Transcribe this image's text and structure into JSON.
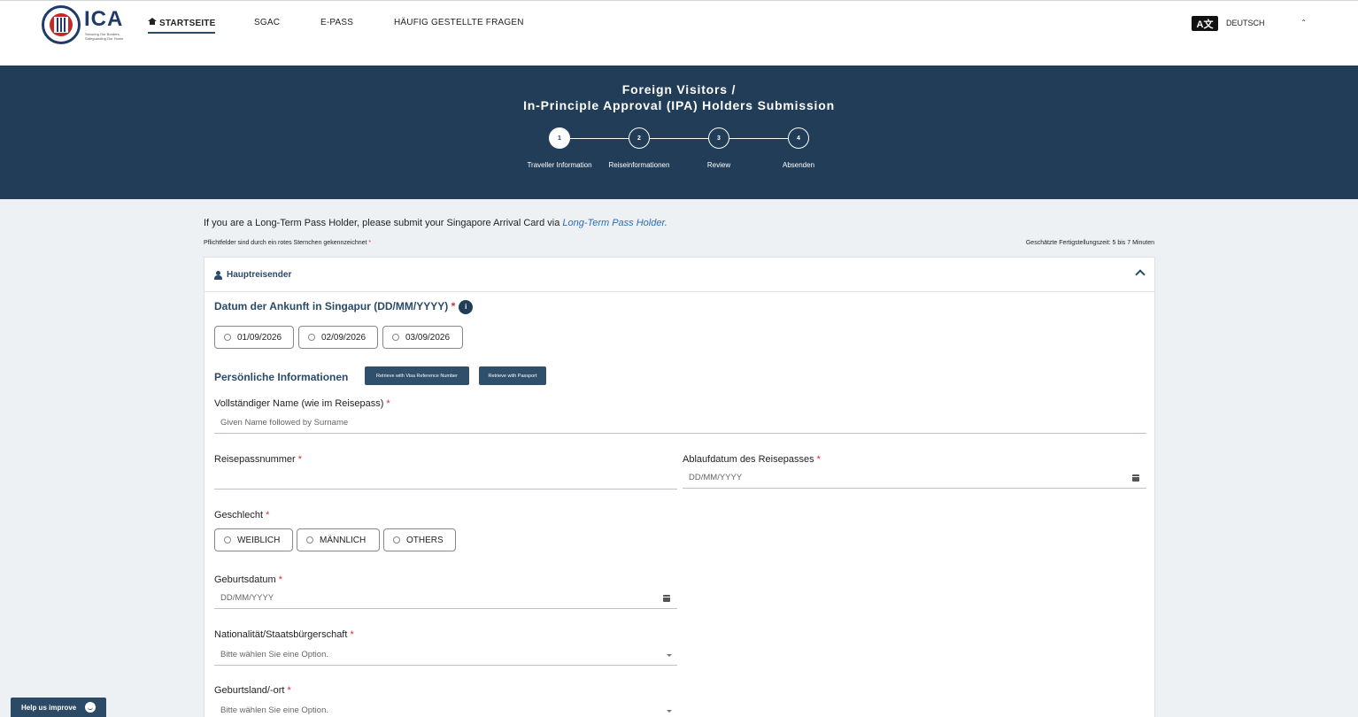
{
  "header": {
    "logo_text": "ICA",
    "logo_tagline": "Securing Our Borders, Safeguarding Our Home",
    "nav": [
      {
        "label": "STARTSEITE"
      },
      {
        "label": "SGAC"
      },
      {
        "label": "E-PASS"
      },
      {
        "label": "HÄUFIG GESTELLTE FRAGEN"
      }
    ],
    "language_icon": "A文",
    "language": "DEUTSCH"
  },
  "banner": {
    "title_line1": "Foreign Visitors /",
    "title_line2": "In-Principle Approval (IPA) Holders Submission",
    "steps": [
      {
        "number": "1",
        "label": "Traveller Information"
      },
      {
        "number": "2",
        "label": "Reiseinformationen"
      },
      {
        "number": "3",
        "label": "Review"
      },
      {
        "number": "4",
        "label": "Absenden"
      }
    ]
  },
  "intro": {
    "text": "If you are a Long-Term Pass Holder, please submit your Singapore Arrival Card via ",
    "link": "Long-Term Pass Holder.",
    "required_note": "Pflichtfelder sind durch ein rotes Sternchen gekennzeichnet",
    "estimated_time": "Geschätzte Fertigstellungszeit: 5 bis 7 Minuten"
  },
  "card": {
    "header_title": "Hauptreisender",
    "arrival_label": "Datum der Ankunft in Singapur (DD/MM/YYYY)",
    "arrival_dates": [
      "01/09/2026",
      "02/09/2026",
      "03/09/2026"
    ],
    "personal_title": "Persönliche Informationen",
    "retrieve_visa": "Retrieve with Visa Reference Number",
    "retrieve_passport": "Retrieve with Passport",
    "full_name_label": "Vollständiger Name (wie im Reisepass)",
    "full_name_placeholder": "Given Name followed by Surname",
    "passport_label": "Reisepassnummer",
    "passport_expiry_label": "Ablaufdatum des Reisepasses",
    "date_placeholder": "DD/MM/YYYY",
    "gender_label": "Geschlecht",
    "genders": [
      "WEIBLICH",
      "MÄNNLICH",
      "OTHERS"
    ],
    "dob_label": "Geburtsdatum",
    "nationality_label": "Nationalität/Staatsbürgerschaft",
    "select_placeholder": "Bitte wählen Sie eine Option.",
    "birthplace_label": "Geburtsland/-ort"
  },
  "help": {
    "label": "Help us improve"
  },
  "colors": {
    "banner": "#223d58",
    "accent": "#2b4a66",
    "required": "#d32f2f"
  }
}
